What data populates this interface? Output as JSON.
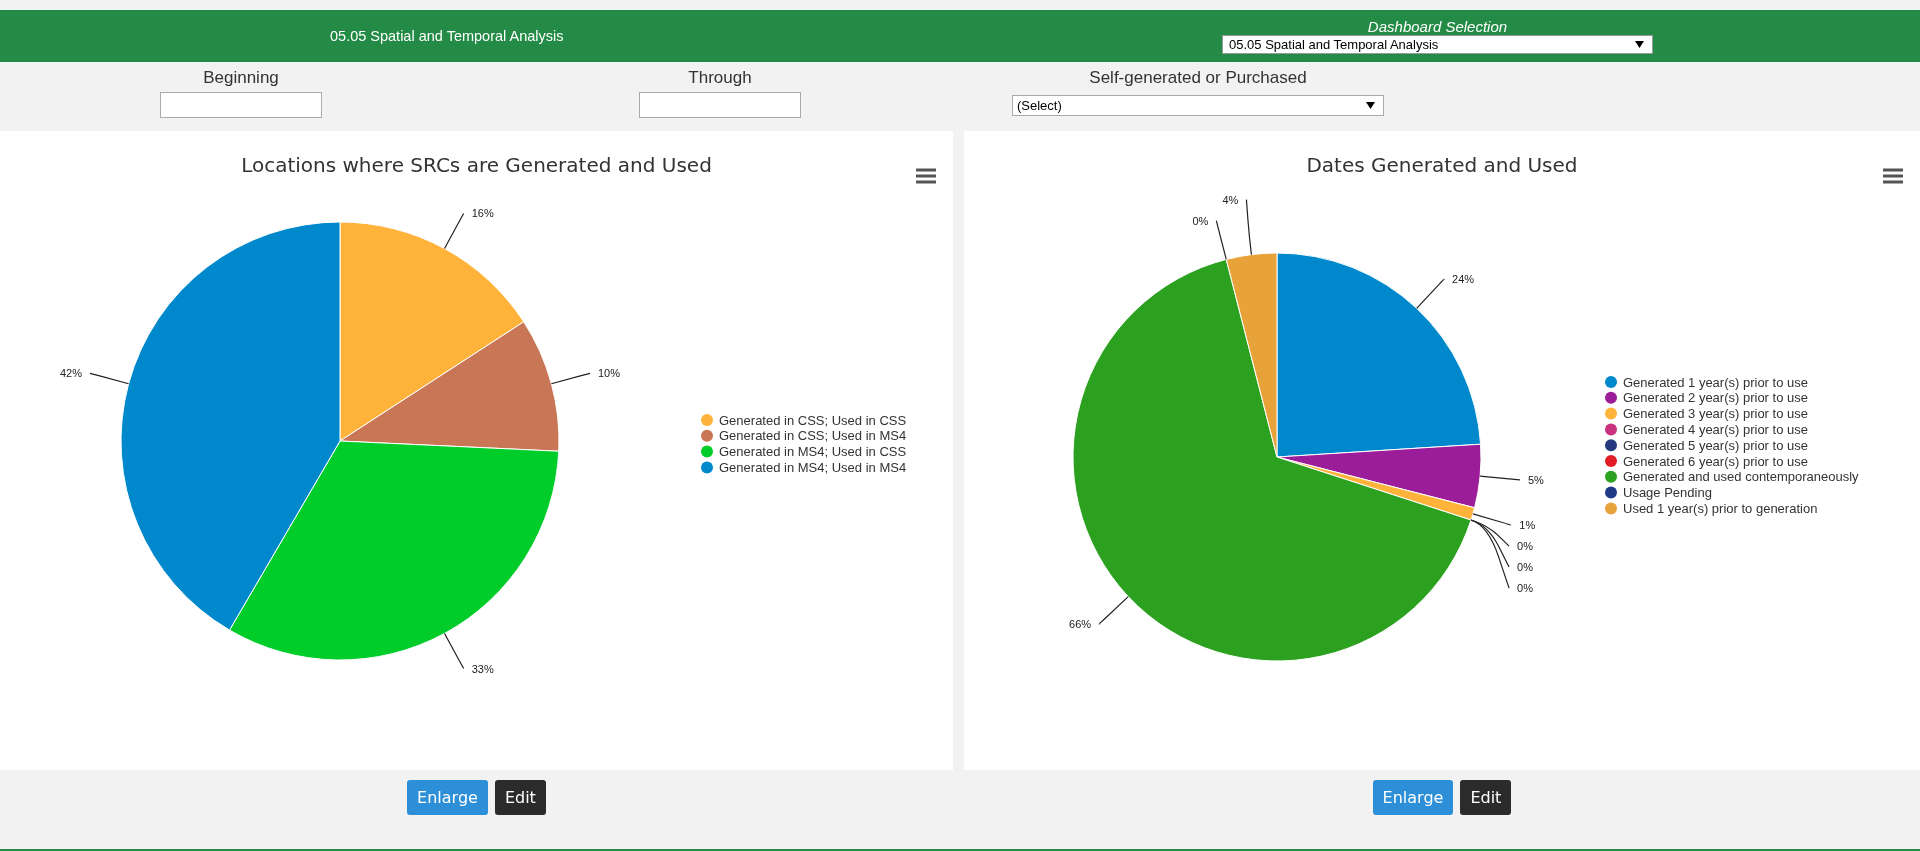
{
  "header": {
    "title": "05.05 Spatial and Temporal Analysis",
    "dashboard_selection": {
      "label": "Dashboard Selection",
      "value": "05.05 Spatial and Temporal Analysis"
    }
  },
  "filters": [
    {
      "kind": "text",
      "label": "Beginning"
    },
    {
      "kind": "text",
      "label": "Through"
    },
    {
      "kind": "select",
      "label": "Self-generated or Purchased",
      "value": "(Select)"
    }
  ],
  "panels": [
    {
      "chart_data": {
        "type": "pie",
        "title": "Locations where SRCs are Generated and Used",
        "categories": [
          "Generated in CSS; Used in CSS",
          "Generated in CSS; Used in MS4",
          "Generated in MS4; Used in CSS",
          "Generated in MS4; Used in MS4"
        ],
        "colors": [
          "#ffb33b",
          "#c87655",
          "#00cc2a",
          "#0088cc"
        ],
        "values": [
          16,
          10,
          33,
          42
        ],
        "value_labels": [
          "16%",
          "10%",
          "33%",
          "42%"
        ],
        "legend": "right"
      },
      "buttons": [
        {
          "kind": "primary",
          "label": "Enlarge"
        },
        {
          "kind": "dark",
          "label": "Edit"
        }
      ]
    },
    {
      "chart_data": {
        "type": "pie",
        "title": "Dates Generated and Used",
        "categories": [
          "Generated 1 year(s) prior to use",
          "Generated 2 year(s) prior to use",
          "Generated 3 year(s) prior to use",
          "Generated 4 year(s) prior to use",
          "Generated 5 year(s) prior to use",
          "Generated 6 year(s) prior to use",
          "Generated and used contemporaneously",
          "Usage Pending",
          "Used 1 year(s) prior to generation"
        ],
        "colors": [
          "#0088cc",
          "#9c1d99",
          "#ffb33b",
          "#c9327c",
          "#233b7e",
          "#e31d25",
          "#2ca01f",
          "#1f3a87",
          "#e8a23a"
        ],
        "values": [
          24,
          5,
          1,
          0,
          0,
          0,
          66,
          0,
          4
        ],
        "value_labels": [
          "24%",
          "5%",
          "1%",
          "0%",
          "0%",
          "0%",
          "66%",
          "0%",
          "4%"
        ],
        "legend": "right"
      },
      "buttons": [
        {
          "kind": "primary",
          "label": "Enlarge"
        },
        {
          "kind": "dark",
          "label": "Edit"
        }
      ]
    }
  ]
}
